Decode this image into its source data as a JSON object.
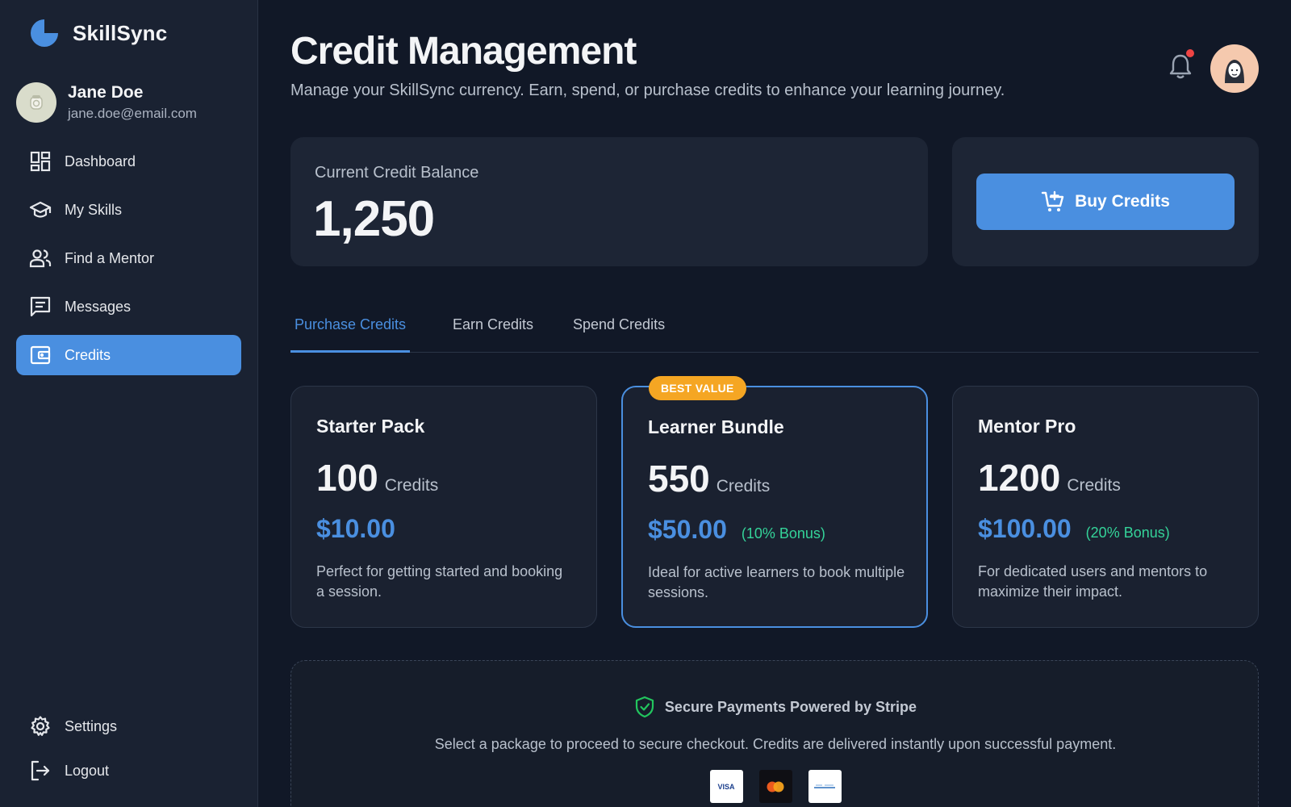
{
  "app": {
    "name": "SkillSync"
  },
  "user": {
    "name": "Jane Doe",
    "email": "jane.doe@email.com"
  },
  "nav": {
    "items": [
      {
        "label": "Dashboard",
        "icon": "dashboard-icon"
      },
      {
        "label": "My Skills",
        "icon": "graduation-cap-icon"
      },
      {
        "label": "Find a Mentor",
        "icon": "people-icon"
      },
      {
        "label": "Messages",
        "icon": "message-icon"
      },
      {
        "label": "Credits",
        "icon": "wallet-icon",
        "active": true
      }
    ],
    "bottom": [
      {
        "label": "Settings",
        "icon": "gear-icon"
      },
      {
        "label": "Logout",
        "icon": "logout-icon"
      }
    ]
  },
  "header": {
    "title": "Credit Management",
    "subtitle": "Manage your SkillSync currency. Earn, spend, or purchase credits to enhance your learning journey.",
    "has_notification": true
  },
  "balance": {
    "label": "Current Credit Balance",
    "value": "1,250"
  },
  "buy": {
    "label": "Buy Credits"
  },
  "tabs": [
    {
      "label": "Purchase Credits",
      "active": true
    },
    {
      "label": "Earn Credits"
    },
    {
      "label": "Spend Credits"
    }
  ],
  "packages": [
    {
      "name": "Starter Pack",
      "credits": "100",
      "unit": "Credits",
      "price": "$10.00",
      "bonus": "",
      "description": "Perfect for getting started and booking a session."
    },
    {
      "name": "Learner Bundle",
      "credits": "550",
      "unit": "Credits",
      "price": "$50.00",
      "bonus": "(10% Bonus)",
      "badge": "BEST VALUE",
      "description": "Ideal for active learners to book multiple sessions."
    },
    {
      "name": "Mentor Pro",
      "credits": "1200",
      "unit": "Credits",
      "price": "$100.00",
      "bonus": "(20% Bonus)",
      "description": "For dedicated users and mentors to maximize their impact."
    }
  ],
  "secure": {
    "title": "Secure Payments Powered by Stripe",
    "text": "Select a package to proceed to secure checkout. Credits are delivered instantly upon successful payment.",
    "card_brands": {
      "visa": "VISA"
    }
  },
  "colors": {
    "accent": "#4a8fe0",
    "badge": "#f5a623",
    "bonus": "#34d399",
    "background": "#111827",
    "sidebar": "#1a2232"
  }
}
